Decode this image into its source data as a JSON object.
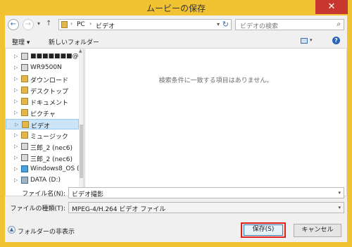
{
  "window": {
    "title": "ムービーの保存",
    "close_glyph": "✕"
  },
  "nav": {
    "back_glyph": "←",
    "forward_glyph": "→",
    "up_glyph": "↑",
    "history_glyph": "▾"
  },
  "address": {
    "crumbs": [
      "PC",
      "ビデオ"
    ],
    "separator": "›",
    "dropdown_glyph": "▾",
    "refresh_glyph": "↻"
  },
  "search": {
    "placeholder": "ビデオの検索",
    "icon_glyph": "⌕"
  },
  "toolbar": {
    "organize_label": "整理 ▾",
    "new_folder_label": "新しいフォルダー",
    "help_glyph": "?",
    "view_dd_glyph": "▾"
  },
  "tree": [
    {
      "label": "■■■■■■■@h",
      "icon": "computer-icon",
      "cls": "computer",
      "selected": false
    },
    {
      "label": "WR9500N",
      "icon": "computer-icon",
      "cls": "computer",
      "selected": false
    },
    {
      "label": "ダウンロード",
      "icon": "folder-icon",
      "cls": "folder",
      "selected": false
    },
    {
      "label": "デスクトップ",
      "icon": "folder-icon",
      "cls": "folder",
      "selected": false
    },
    {
      "label": "ドキュメント",
      "icon": "folder-icon",
      "cls": "folder",
      "selected": false
    },
    {
      "label": "ピクチャ",
      "icon": "folder-icon",
      "cls": "folder",
      "selected": false
    },
    {
      "label": "ビデオ",
      "icon": "folder-icon",
      "cls": "folder",
      "selected": true
    },
    {
      "label": "ミュージック",
      "icon": "music-folder-icon",
      "cls": "music",
      "selected": false
    },
    {
      "label": "三郎_2 (nec6)",
      "icon": "computer-icon",
      "cls": "computer",
      "selected": false
    },
    {
      "label": "三郎_2 (nec6)",
      "icon": "computer-icon",
      "cls": "computer",
      "selected": false
    },
    {
      "label": "Windows8_OS (",
      "icon": "windows-drive-icon",
      "cls": "win",
      "selected": false
    },
    {
      "label": "DATA (D:)",
      "icon": "drive-icon",
      "cls": "drive",
      "selected": false
    }
  ],
  "tree_arrow_glyph": "▷",
  "content": {
    "empty_message": "検索条件に一致する項目はありません。"
  },
  "filename": {
    "label": "ファイル名(N):",
    "value": "ビデオ撮影"
  },
  "filetype": {
    "label": "ファイルの種類(T):",
    "value": "MPEG-4/H.264 ビデオ ファイル"
  },
  "dropdown_glyph": "▾",
  "footer": {
    "hide_folders_label": "フォルダーの非表示",
    "hide_glyph": "▲",
    "save_label": "保存(S)",
    "cancel_label": "キャンセル"
  },
  "scroll": {
    "up_glyph": "▲",
    "down_glyph": "▼"
  },
  "colors": {
    "title_bar": "#f1c232",
    "close_button": "#c7372f",
    "highlight_border": "#e1221c",
    "selection": "#cce4f7"
  }
}
